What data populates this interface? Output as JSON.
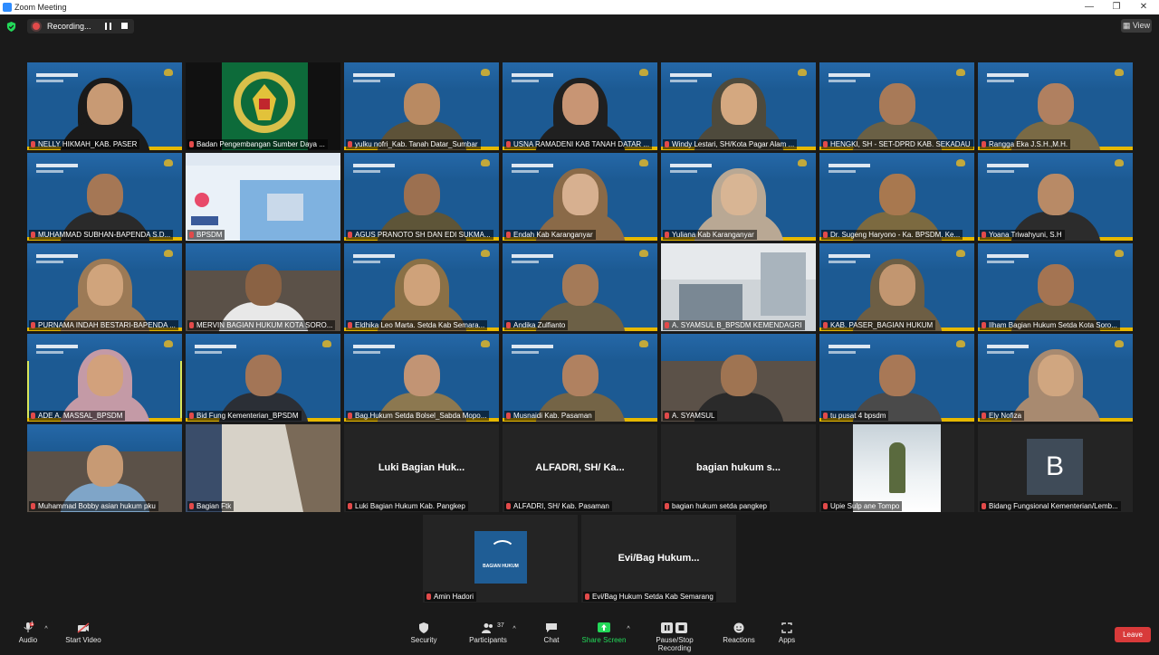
{
  "window": {
    "title": "Zoom Meeting"
  },
  "recording": {
    "label": "Recording..."
  },
  "view": {
    "label": "View"
  },
  "participants": [
    {
      "name": "NELLY HIKMAH_KAB. PASER",
      "kind": "video",
      "skin": "#c89a74",
      "outfit": "#1a1a1a",
      "hijab": true
    },
    {
      "name": "Badan Pengembangan Sumber Daya ...",
      "kind": "emblem"
    },
    {
      "name": "yulku nofri_Kab. Tanah Datar_Sumbar",
      "kind": "video",
      "skin": "#b98a62",
      "outfit": "#5d5238"
    },
    {
      "name": "USNA RAMADENI KAB TANAH DATAR ...",
      "kind": "video",
      "skin": "#c89574",
      "outfit": "#202020",
      "hijab": true
    },
    {
      "name": "Windy Lestari, SH/Kota Pagar Alam ...",
      "kind": "video",
      "skin": "#d4a880",
      "outfit": "#4e4a3c",
      "hijab": true
    },
    {
      "name": "HENGKI, SH - SET-DPRD KAB. SEKADAU",
      "kind": "video",
      "skin": "#a87a58",
      "outfit": "#6a6045"
    },
    {
      "name": "Rangga Eka J.S.H.,M.H.",
      "kind": "video",
      "skin": "#b08060",
      "outfit": "#7a6a45"
    },
    {
      "name": "MUHAMMAD SUBHAN-BAPENDA S.D...",
      "kind": "video",
      "skin": "#a57755",
      "outfit": "#2a2a2a"
    },
    {
      "name": "BPSDM",
      "kind": "banner"
    },
    {
      "name": "AGUS PRANOTO SH DAN EDI SUKMA...",
      "kind": "video",
      "skin": "#9c7050",
      "outfit": "#5e5538"
    },
    {
      "name": "Endah Kab Karanganyar",
      "kind": "video",
      "skin": "#d7b090",
      "outfit": "#8a6a48",
      "hijab": true
    },
    {
      "name": "Yuliana Kab Karanganyar",
      "kind": "video",
      "skin": "#d8b594",
      "outfit": "#b9a894",
      "hijab": true
    },
    {
      "name": "Dr. Sugeng Haryono - Ka. BPSDM. Ke...",
      "kind": "video",
      "skin": "#a8784f",
      "outfit": "#7c6a40"
    },
    {
      "name": "Yoana Triwahyuni, S.H",
      "kind": "video",
      "skin": "#b88a66",
      "outfit": "#2c2c2c"
    },
    {
      "name": "PURNAMA INDAH BESTARI-BAPENDA ...",
      "kind": "video",
      "skin": "#d0a47c",
      "outfit": "#9c7a56",
      "hijab": true
    },
    {
      "name": "MERVIN BAGIAN HUKUM KOTA SORO...",
      "kind": "room",
      "skin": "#8a6244",
      "outfit": "#e8e8e8"
    },
    {
      "name": "Eldhika Leo Marta. Setda Kab Semara...",
      "kind": "video",
      "skin": "#cfa27a",
      "outfit": "#8a7046",
      "hijab": true
    },
    {
      "name": "Andika Zulfianto",
      "kind": "video",
      "skin": "#a47a58",
      "outfit": "#6c6046"
    },
    {
      "name": "A. SYAMSUL B_BPSDM KEMENDAGRI",
      "kind": "office"
    },
    {
      "name": "KAB. PASER_BAGIAN HUKUM",
      "kind": "video",
      "skin": "#c29670",
      "outfit": "#6d5e44",
      "hijab": true
    },
    {
      "name": "Ilham Bagian Hukum Setda Kota Soro...",
      "kind": "video",
      "skin": "#a47452",
      "outfit": "#6a5c3e"
    },
    {
      "name": "ADE A. MASSAL_BPSDM",
      "kind": "video",
      "skin": "#d2a17c",
      "outfit": "#c49aa6",
      "hijab": true,
      "active": true
    },
    {
      "name": "Bid Fung Kementerian_BPSDM",
      "kind": "video",
      "skin": "#a37556",
      "outfit": "#2b2f36"
    },
    {
      "name": "Bag.Hukum Setda Bolsel_Sabda Mopo...",
      "kind": "video",
      "skin": "#c29474",
      "outfit": "#8c7850"
    },
    {
      "name": "Musnaidi Kab. Pasaman",
      "kind": "video",
      "skin": "#b08160",
      "outfit": "#746446"
    },
    {
      "name": "A. SYAMSUL",
      "kind": "room",
      "skin": "#9f7452",
      "outfit": "#2a2a2a"
    },
    {
      "name": "tu pusat 4 bpsdm",
      "kind": "video",
      "skin": "#a87856",
      "outfit": "#4a4a4a"
    },
    {
      "name": "Ely Nofiza",
      "kind": "video",
      "skin": "#d0a680",
      "outfit": "#a88a70",
      "hijab": true
    },
    {
      "name": "Muhammad Bobby asian hukum pku",
      "kind": "room",
      "skin": "#c79a74",
      "outfit": "#7fa5c8"
    },
    {
      "name": "Bagian Ftk",
      "kind": "blur"
    },
    {
      "name": "Luki Bagian Hukum Kab. Pangkep",
      "kind": "name",
      "display": "Luki Bagian Huk..."
    },
    {
      "name": "ALFADRI, SH/ Kab. Pasaman",
      "kind": "name",
      "display": "ALFADRI, SH/ Ka..."
    },
    {
      "name": "bagian hukum setda pangkep",
      "kind": "name",
      "display": "bagian hukum s..."
    },
    {
      "name": "Upie Sulp ane Tompo",
      "kind": "picture"
    },
    {
      "name": "Bidang Fungsional Kementerian/Lemb...",
      "kind": "letter",
      "letter": "B"
    },
    {
      "name": "Amin Hadori",
      "kind": "logo",
      "logo_text": "BAGIAN HUKUM"
    },
    {
      "name": "Evi/Bag Hukum Setda Kab Semarang",
      "kind": "name",
      "display": "Evi/Bag Hukum..."
    }
  ],
  "toolbar": {
    "audio": "Audio",
    "audio_badge": "1",
    "start_video": "Start Video",
    "security": "Security",
    "participants": "Participants",
    "participants_count": "37",
    "chat": "Chat",
    "share_screen": "Share Screen",
    "pause_recording": "Pause/Stop Recording",
    "reactions": "Reactions",
    "apps": "Apps",
    "leave": "Leave"
  },
  "colors": {
    "accent_green": "#23d959",
    "leave_red": "#d83a3a",
    "active_border": "#d8e65a"
  }
}
